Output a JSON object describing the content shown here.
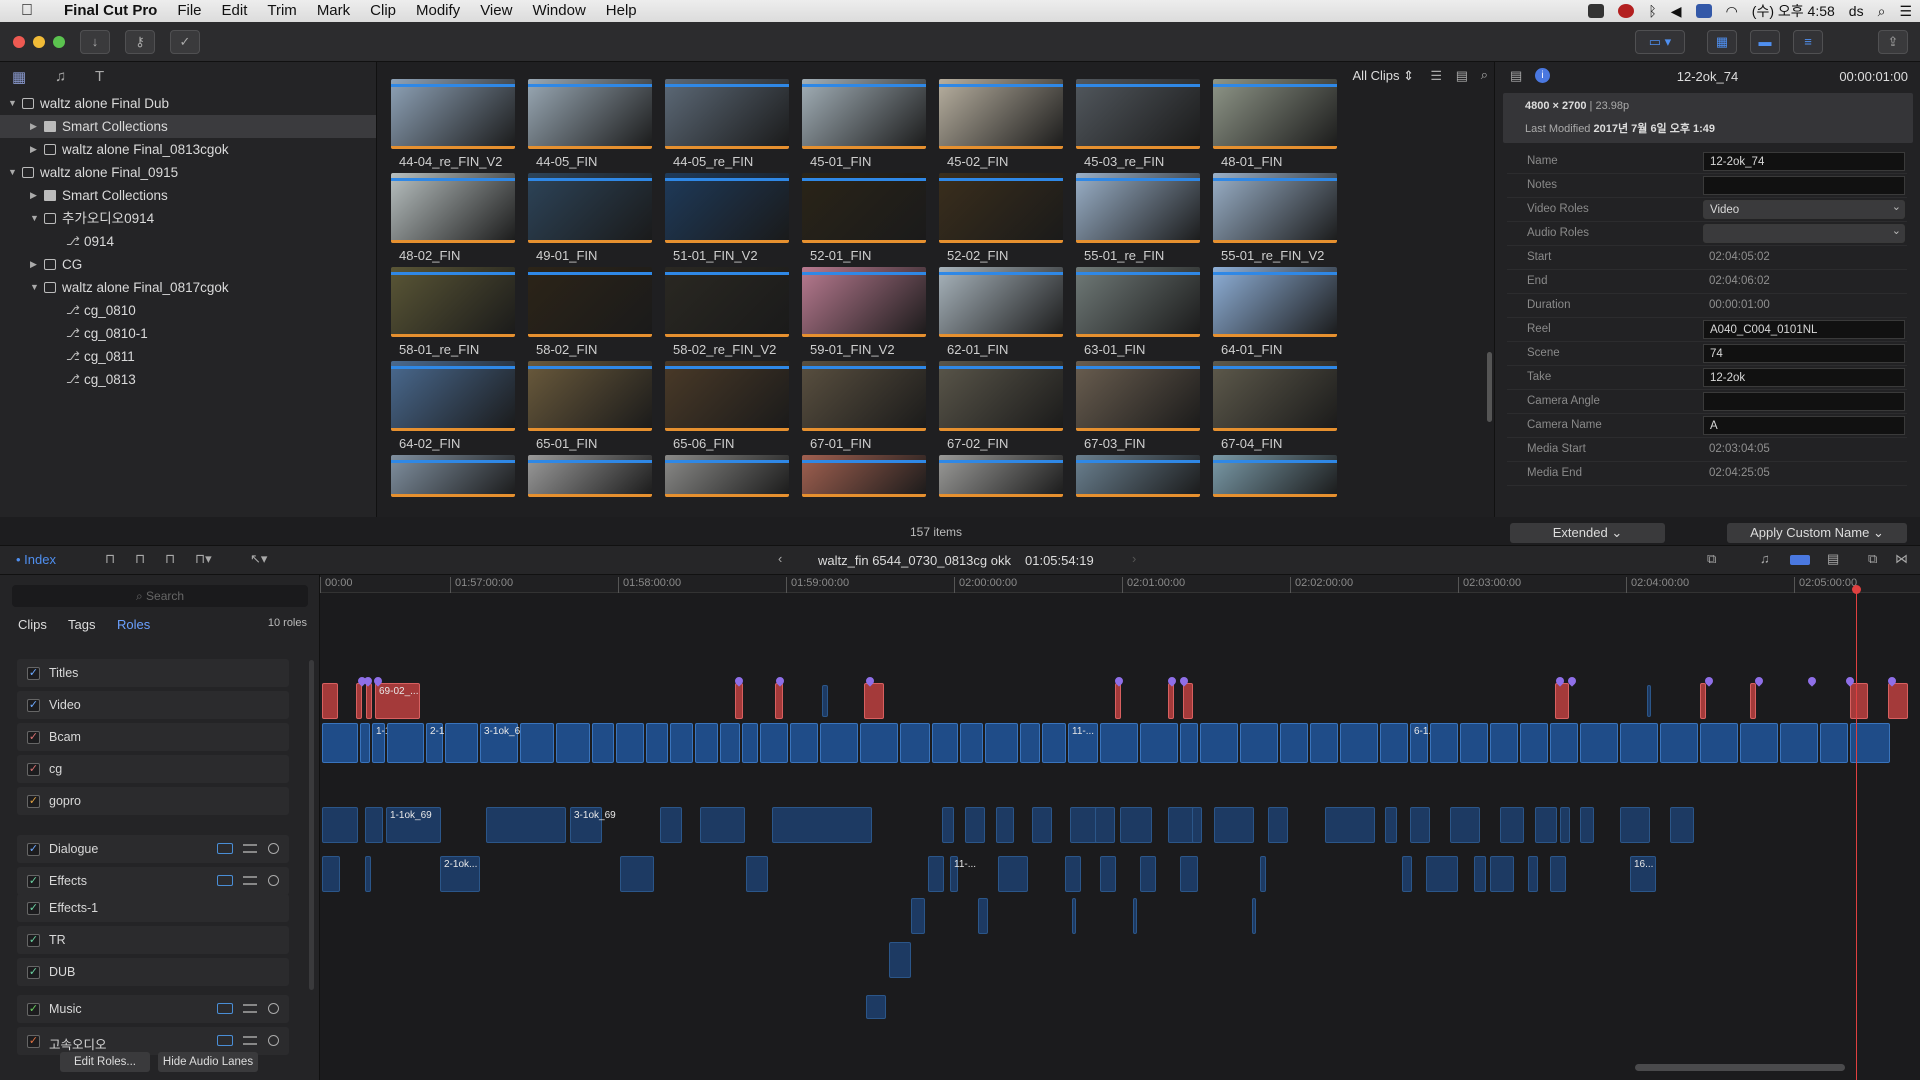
{
  "menubar": {
    "app": "Final Cut Pro",
    "items": [
      "File",
      "Edit",
      "Trim",
      "Mark",
      "Clip",
      "Modify",
      "View",
      "Window",
      "Help"
    ],
    "clock": "(수) 오후 4:58",
    "user": "ds"
  },
  "library": {
    "rows": [
      {
        "label": "waltz alone Final Dub",
        "level": 0,
        "tri": "▼",
        "icon": "library"
      },
      {
        "label": "Smart Collections",
        "level": 1,
        "tri": "▶",
        "icon": "folder",
        "selected": true
      },
      {
        "label": "waltz alone Final_0813cgok",
        "level": 1,
        "tri": "▶",
        "icon": "event"
      },
      {
        "label": "waltz alone Final_0915",
        "level": 0,
        "tri": "▼",
        "icon": "library"
      },
      {
        "label": "Smart Collections",
        "level": 1,
        "tri": "▶",
        "icon": "folder"
      },
      {
        "label": "추가오디오0914",
        "level": 1,
        "tri": "▼",
        "icon": "event"
      },
      {
        "label": "0914",
        "level": 2,
        "tri": "",
        "icon": "project"
      },
      {
        "label": "CG",
        "level": 1,
        "tri": "▶",
        "icon": "event"
      },
      {
        "label": "waltz alone Final_0817cgok",
        "level": 1,
        "tri": "▼",
        "icon": "event"
      },
      {
        "label": "cg_0810",
        "level": 2,
        "tri": "",
        "icon": "project"
      },
      {
        "label": "cg_0810-1",
        "level": 2,
        "tri": "",
        "icon": "project"
      },
      {
        "label": "cg_0811",
        "level": 2,
        "tri": "",
        "icon": "project"
      },
      {
        "label": "cg_0813",
        "level": 2,
        "tri": "",
        "icon": "project"
      }
    ]
  },
  "browser": {
    "filter": "All Clips",
    "count": "157 items",
    "clips": [
      {
        "name": "44-04_re_FIN_V2",
        "color": "#8fa3b8"
      },
      {
        "name": "44-05_FIN",
        "color": "#9aa9b5"
      },
      {
        "name": "44-05_re_FIN",
        "color": "#5d6a78"
      },
      {
        "name": "45-01_FIN",
        "color": "#a3b0b8"
      },
      {
        "name": "45-02_FIN",
        "color": "#b8b0a0"
      },
      {
        "name": "45-03_re_FIN",
        "color": "#52585e"
      },
      {
        "name": "48-01_FIN",
        "color": "#8f9688"
      },
      {
        "name": "48-02_FIN",
        "color": "#b8c0c0"
      },
      {
        "name": "49-01_FIN",
        "color": "#2d4459"
      },
      {
        "name": "51-01_FIN_V2",
        "color": "#1e3a5a"
      },
      {
        "name": "52-01_FIN",
        "color": "#2a2418"
      },
      {
        "name": "52-02_FIN",
        "color": "#3a2e1c"
      },
      {
        "name": "55-01_re_FIN",
        "color": "#9ab0c8"
      },
      {
        "name": "55-01_re_FIN_V2",
        "color": "#9ab0c8"
      },
      {
        "name": "58-01_re_FIN",
        "color": "#5a5636"
      },
      {
        "name": "58-02_FIN",
        "color": "#2c2418"
      },
      {
        "name": "58-02_re_FIN_V2",
        "color": "#2a2822"
      },
      {
        "name": "59-01_FIN_V2",
        "color": "#b87a90"
      },
      {
        "name": "62-01_FIN",
        "color": "#a8b4bc"
      },
      {
        "name": "63-01_FIN",
        "color": "#707a78"
      },
      {
        "name": "64-01_FIN",
        "color": "#8fb0d8"
      },
      {
        "name": "64-02_FIN",
        "color": "#4a6a90"
      },
      {
        "name": "65-01_FIN",
        "color": "#6a5a3c"
      },
      {
        "name": "65-06_FIN",
        "color": "#4a3a28"
      },
      {
        "name": "67-01_FIN",
        "color": "#5a5040"
      },
      {
        "name": "67-02_FIN",
        "color": "#5a564a"
      },
      {
        "name": "67-03_FIN",
        "color": "#6a5e50"
      },
      {
        "name": "67-04_FIN",
        "color": "#5e5a4c"
      },
      {
        "name": "",
        "color": "#8090a0"
      },
      {
        "name": "",
        "color": "#9a9a9a"
      },
      {
        "name": "",
        "color": "#8a8a88"
      },
      {
        "name": "",
        "color": "#a06050"
      },
      {
        "name": "",
        "color": "#9a9a98"
      },
      {
        "name": "",
        "color": "#6a8090"
      },
      {
        "name": "",
        "color": "#7a9aa8"
      }
    ]
  },
  "inspector": {
    "title": "12-2ok_74",
    "timecode": "00:00:01:00",
    "resolution": "4800 × 2700",
    "fps": "| 23.98p",
    "modified_label": "Last Modified",
    "modified_value": "2017년 7월 6일 오후 1:49",
    "fields": [
      {
        "k": "Name",
        "v": "12-2ok_74",
        "style": "box"
      },
      {
        "k": "Notes",
        "v": "",
        "style": "box"
      },
      {
        "k": "Video Roles",
        "v": "Video",
        "style": "select"
      },
      {
        "k": "Audio Roles",
        "v": "",
        "style": "select"
      },
      {
        "k": "Start",
        "v": "02:04:05:02",
        "style": "plain"
      },
      {
        "k": "End",
        "v": "02:04:06:02",
        "style": "plain"
      },
      {
        "k": "Duration",
        "v": "00:00:01:00",
        "style": "plain"
      },
      {
        "k": "Reel",
        "v": "A040_C004_0101NL",
        "style": "box"
      },
      {
        "k": "Scene",
        "v": "74",
        "style": "box"
      },
      {
        "k": "Take",
        "v": "12-2ok",
        "style": "box"
      },
      {
        "k": "Camera Angle",
        "v": "",
        "style": "box"
      },
      {
        "k": "Camera Name",
        "v": "A",
        "style": "box"
      },
      {
        "k": "Media Start",
        "v": "02:03:04:05",
        "style": "plain"
      },
      {
        "k": "Media End",
        "v": "02:04:25:05",
        "style": "plain"
      }
    ],
    "view": "Extended",
    "apply": "Apply Custom Name"
  },
  "timeline": {
    "index_label": "Index",
    "project": "waltz_fin 6544_0730_0813cg okk",
    "timecode": "01:05:54:19",
    "ruler": [
      "00:00",
      "01:57:00:00",
      "01:58:00:00",
      "01:59:00:00",
      "02:00:00:00",
      "02:01:00:00",
      "02:02:00:00",
      "02:03:00:00",
      "02:04:00:00",
      "02:05:00:00"
    ]
  },
  "index": {
    "search_placeholder": "Search",
    "tabs": [
      "Clips",
      "Tags",
      "Roles"
    ],
    "roles_count": "10 roles",
    "roles": [
      {
        "name": "Titles",
        "lanes": false
      },
      {
        "name": "Video",
        "lanes": false
      },
      {
        "name": "Bcam",
        "lanes": false
      },
      {
        "name": "cg",
        "lanes": false
      },
      {
        "name": "gopro",
        "lanes": false
      },
      {
        "name": "Dialogue",
        "lanes": true
      },
      {
        "name": "Effects",
        "lanes": true
      },
      {
        "name": "Effects-1",
        "lanes": false
      },
      {
        "name": "TR",
        "lanes": false
      },
      {
        "name": "DUB",
        "lanes": false
      },
      {
        "name": "Music",
        "lanes": true
      },
      {
        "name": "고속오디오",
        "lanes": true
      }
    ],
    "edit_roles": "Edit Roles...",
    "hide_lanes": "Hide Audio Lanes"
  },
  "clip_labels": {
    "a": "1-1ok_69",
    "b": "2-1ok...",
    "c": "3-1ok_69",
    "d": "69-02_...",
    "e": "11-...",
    "f": "6-1...",
    "g": "16..."
  },
  "colors": {
    "accent": "#2f88e6",
    "selection": "#e6902f"
  }
}
